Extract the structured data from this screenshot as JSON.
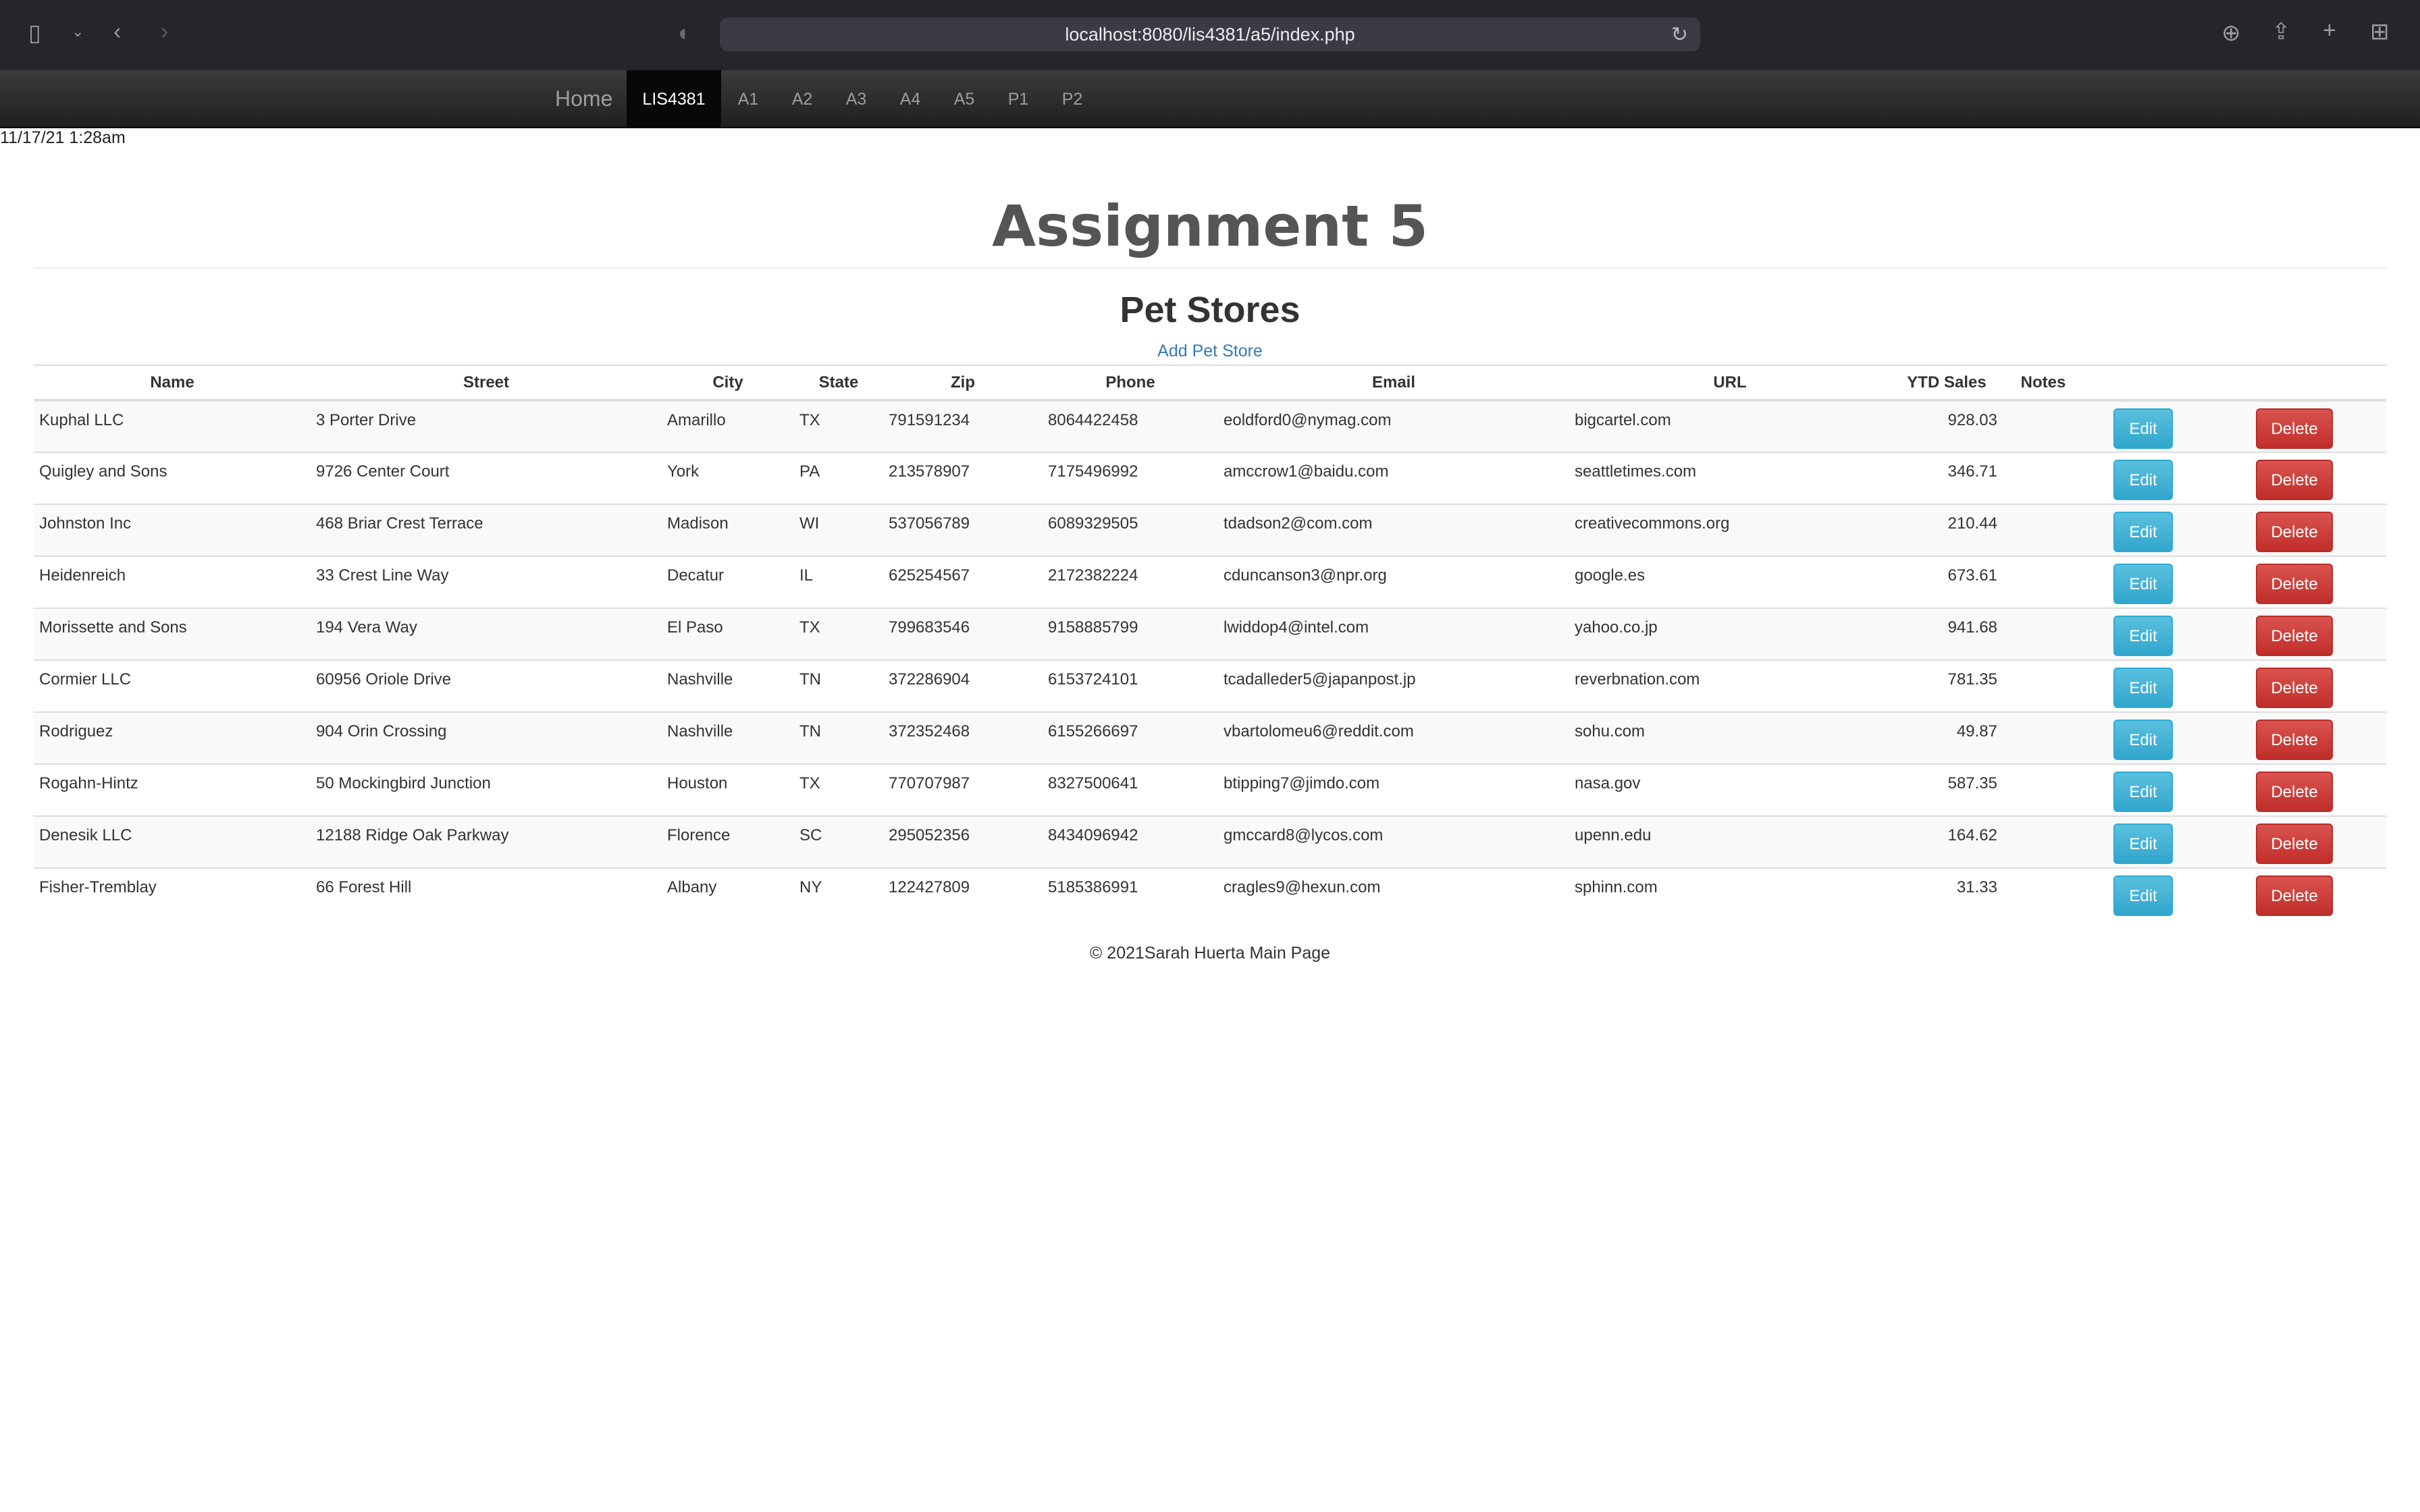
{
  "browser": {
    "url": "localhost:8080/lis4381/a5/index.php"
  },
  "navbar": {
    "brand": "Home",
    "items": [
      {
        "label": "LIS4381",
        "active": true
      },
      {
        "label": "A1"
      },
      {
        "label": "A2"
      },
      {
        "label": "A3"
      },
      {
        "label": "A4"
      },
      {
        "label": "A5"
      },
      {
        "label": "P1"
      },
      {
        "label": "P2"
      }
    ]
  },
  "datetime": "11/17/21 1:28am",
  "page": {
    "title": "Assignment 5",
    "subtitle": "Pet Stores",
    "add_link": "Add Pet Store"
  },
  "table": {
    "headers": [
      "Name",
      "Street",
      "City",
      "State",
      "Zip",
      "Phone",
      "Email",
      "URL",
      "YTD Sales",
      "Notes",
      "",
      ""
    ],
    "edit_label": "Edit",
    "delete_label": "Delete",
    "rows": [
      {
        "name": "Kuphal LLC",
        "street": "3 Porter Drive",
        "city": "Amarillo",
        "state": "TX",
        "zip": "791591234",
        "phone": "8064422458",
        "email": "eoldford0@nymag.com",
        "url": "bigcartel.com",
        "sales": "928.03",
        "notes": ""
      },
      {
        "name": "Quigley and Sons",
        "street": "9726 Center Court",
        "city": "York",
        "state": "PA",
        "zip": "213578907",
        "phone": "7175496992",
        "email": "amccrow1@baidu.com",
        "url": "seattletimes.com",
        "sales": "346.71",
        "notes": ""
      },
      {
        "name": "Johnston Inc",
        "street": "468 Briar Crest Terrace",
        "city": "Madison",
        "state": "WI",
        "zip": "537056789",
        "phone": "6089329505",
        "email": "tdadson2@com.com",
        "url": "creativecommons.org",
        "sales": "210.44",
        "notes": ""
      },
      {
        "name": "Heidenreich",
        "street": "33 Crest Line Way",
        "city": "Decatur",
        "state": "IL",
        "zip": "625254567",
        "phone": "2172382224",
        "email": "cduncanson3@npr.org",
        "url": "google.es",
        "sales": "673.61",
        "notes": ""
      },
      {
        "name": "Morissette and Sons",
        "street": "194 Vera Way",
        "city": "El Paso",
        "state": "TX",
        "zip": "799683546",
        "phone": "9158885799",
        "email": "lwiddop4@intel.com",
        "url": "yahoo.co.jp",
        "sales": "941.68",
        "notes": ""
      },
      {
        "name": "Cormier LLC",
        "street": "60956 Oriole Drive",
        "city": "Nashville",
        "state": "TN",
        "zip": "372286904",
        "phone": "6153724101",
        "email": "tcadalleder5@japanpost.jp",
        "url": "reverbnation.com",
        "sales": "781.35",
        "notes": ""
      },
      {
        "name": "Rodriguez",
        "street": "904 Orin Crossing",
        "city": "Nashville",
        "state": "TN",
        "zip": "372352468",
        "phone": "6155266697",
        "email": "vbartolomeu6@reddit.com",
        "url": "sohu.com",
        "sales": "49.87",
        "notes": ""
      },
      {
        "name": "Rogahn-Hintz",
        "street": "50 Mockingbird Junction",
        "city": "Houston",
        "state": "TX",
        "zip": "770707987",
        "phone": "8327500641",
        "email": "btipping7@jimdo.com",
        "url": "nasa.gov",
        "sales": "587.35",
        "notes": ""
      },
      {
        "name": "Denesik LLC",
        "street": "12188 Ridge Oak Parkway",
        "city": "Florence",
        "state": "SC",
        "zip": "295052356",
        "phone": "8434096942",
        "email": "gmccard8@lycos.com",
        "url": "upenn.edu",
        "sales": "164.62",
        "notes": ""
      },
      {
        "name": "Fisher-Tremblay",
        "street": "66 Forest Hill",
        "city": "Albany",
        "state": "NY",
        "zip": "122427809",
        "phone": "5185386991",
        "email": "cragles9@hexun.com",
        "url": "sphinn.com",
        "sales": "31.33",
        "notes": ""
      }
    ]
  },
  "footer": "© 2021Sarah Huerta Main Page"
}
